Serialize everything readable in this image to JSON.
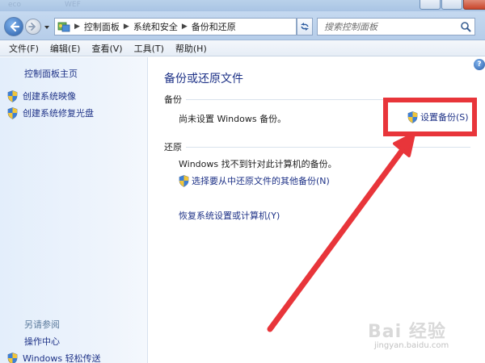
{
  "window": {
    "title_ghost_left": "eco",
    "title_ghost_right": "WEF"
  },
  "navigation": {
    "back_icon": "back-arrow-icon",
    "forward_icon": "forward-arrow-icon",
    "breadcrumbs": [
      "控制面板",
      "系统和安全",
      "备份和还原"
    ],
    "search_placeholder": "搜索控制面板"
  },
  "menu": {
    "items": [
      "文件(F)",
      "编辑(E)",
      "查看(V)",
      "工具(T)",
      "帮助(H)"
    ]
  },
  "sidebar": {
    "home_link": "控制面板主页",
    "tasks": [
      "创建系统映像",
      "创建系统修复光盘"
    ],
    "see_also_header": "另请参阅",
    "see_also": [
      "操作中心",
      "Windows 轻松传送"
    ]
  },
  "main": {
    "title": "备份或还原文件",
    "backup": {
      "label": "备份",
      "status": "尚未设置 Windows 备份。",
      "setup_link": "设置备份(S)"
    },
    "restore": {
      "label": "还原",
      "status": "Windows 找不到针对此计算机的备份。",
      "other_backup_link": "选择要从中还原文件的其他备份(N)",
      "recover_link": "恢复系统设置或计算机(Y)"
    }
  },
  "annotation": {
    "arrow_color": "#e8353a"
  },
  "watermark": {
    "brand": "Bai 经验",
    "url": "jingyan.baidu.com"
  },
  "colors": {
    "link": "#1e3287",
    "title": "#1e3287"
  }
}
